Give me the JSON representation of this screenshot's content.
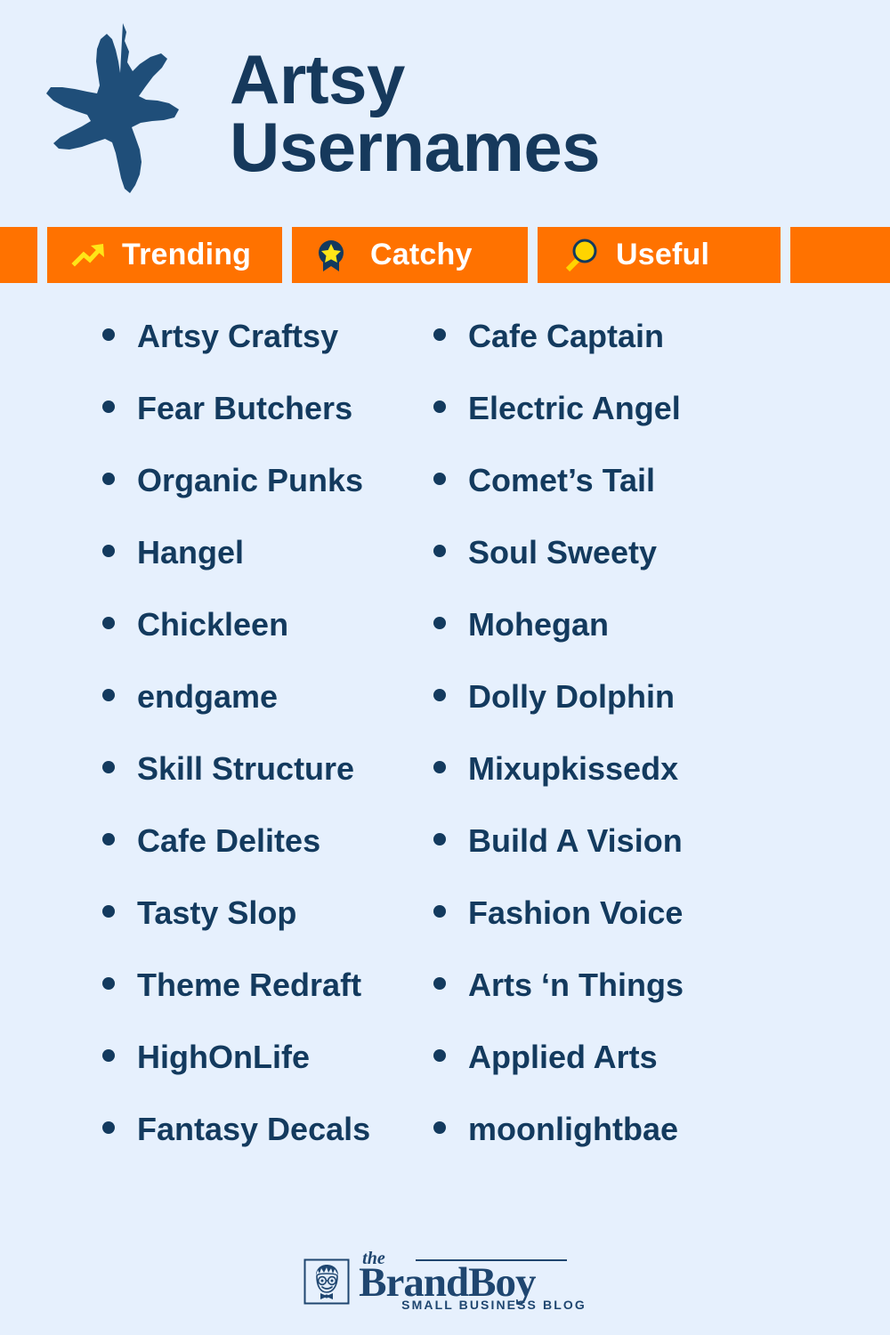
{
  "header": {
    "title_line1": "Artsy",
    "title_line2": "Usernames",
    "logo_icon": "star-icon",
    "title_color": "#16395c",
    "background_color": "#e6f0fd"
  },
  "badge_bar": {
    "background_color": "#ff7200",
    "label_color": "#ffffff",
    "badges": [
      {
        "label": "Trending",
        "icon": "trending-up-arrow-icon",
        "icon_color": "#ffe617"
      },
      {
        "label": "Catchy",
        "icon": "award-ribbon-star-icon",
        "icon_color": "#133a5e"
      },
      {
        "label": "Useful",
        "icon": "magnifying-glass-icon",
        "icon_color": "#ffd400"
      }
    ]
  },
  "lists": {
    "text_color": "#133a5e",
    "left_column": [
      "Artsy Craftsy",
      "Fear Butchers",
      "Organic Punks",
      "Hangel",
      "Chickleen",
      "endgame",
      "Skill Structure",
      "Cafe Delites",
      "Tasty Slop",
      "Theme Redraft",
      "HighOnLife",
      "Fantasy Decals"
    ],
    "right_column": [
      "Cafe Captain",
      "Electric Angel",
      "Comet’s Tail",
      "Soul Sweety",
      "Mohegan",
      "Dolly Dolphin",
      "Mixupkissedx",
      "Build A Vision",
      "Fashion Voice",
      "Arts ‘n Things",
      "Applied Arts",
      "moonlightbae"
    ]
  },
  "footer": {
    "logo_mark_icon": "boy-face-with-glasses-icon",
    "brand_the": "the",
    "brand_name": "BrandBoy",
    "brand_tagline": "SMALL BUSINESS BLOG",
    "brand_color": "#1f4670"
  }
}
